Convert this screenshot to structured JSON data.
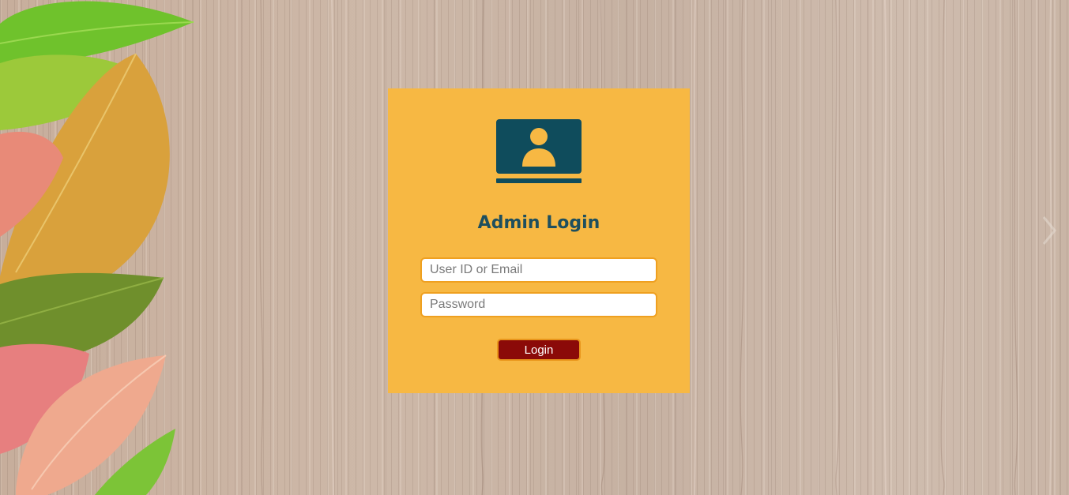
{
  "login": {
    "title": "Admin Login",
    "user_placeholder": "User ID or Email",
    "password_placeholder": "Password",
    "submit_label": "Login"
  },
  "icons": {
    "admin": "admin-laptop-icon",
    "next": "chevron-right-icon"
  },
  "colors": {
    "card": "#f7b843",
    "title": "#1e4f5e",
    "icon": "#0f4c5c",
    "button": "#8b0a08",
    "field_border": "#efa020"
  }
}
